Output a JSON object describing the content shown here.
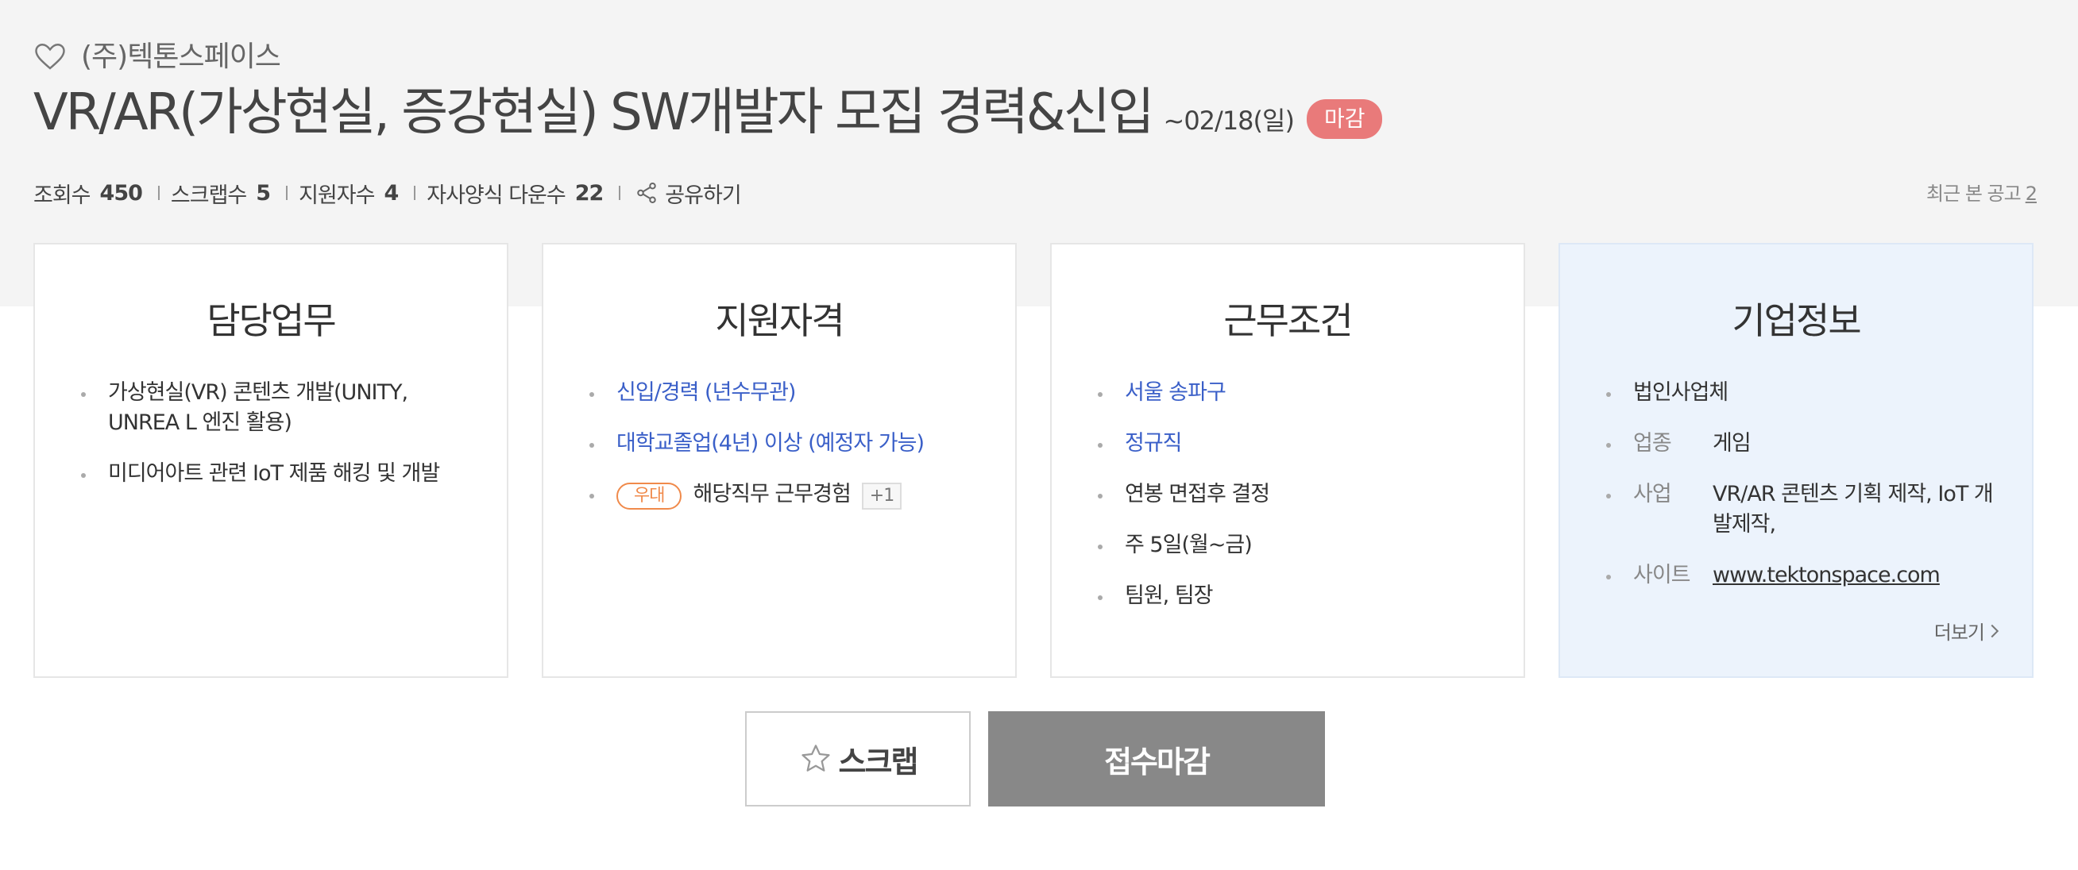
{
  "header": {
    "company_name": "(주)텍톤스페이스",
    "job_title": "VR/AR(가상현실, 증강현실) SW개발자 모집 경력&신입",
    "deadline": "~02/18(일)",
    "status_badge": "마감"
  },
  "stats": [
    {
      "label": "조회수",
      "value": "450"
    },
    {
      "label": "스크랩수",
      "value": "5"
    },
    {
      "label": "지원자수",
      "value": "4"
    },
    {
      "label": "자사양식 다운수",
      "value": "22"
    }
  ],
  "share_label": "공유하기",
  "recent": {
    "label": "최근 본 공고",
    "count": "2"
  },
  "cards": {
    "duties": {
      "title": "담당업무",
      "items": [
        "가상현실(VR) 콘텐츠 개발(UNITY, UNREA L 엔진 활용)",
        "미디어아트 관련 IoT 제품 해킹 및 개발"
      ]
    },
    "qualifications": {
      "title": "지원자격",
      "items": [
        "신입/경력 (년수무관)",
        "대학교졸업(4년) 이상 (예정자 가능)"
      ],
      "preferred_badge": "우대",
      "preferred_text": "해당직무 근무경험",
      "more_chip": "+1"
    },
    "conditions": {
      "title": "근무조건",
      "items": [
        "서울 송파구",
        "정규직",
        "연봉 면접후 결정",
        "주 5일(월~금)",
        "팀원, 팀장"
      ]
    },
    "company": {
      "title": "기업정보",
      "type": "법인사업체",
      "industry_label": "업종",
      "industry": "게임",
      "business_label": "사업",
      "business": "VR/AR 콘텐츠 기획 제작, IoT 개발제작,",
      "site_label": "사이트",
      "site": "www.tektonspace.com",
      "more_label": "더보기"
    }
  },
  "buttons": {
    "scrap": "스크랩",
    "apply": "접수마감"
  },
  "colors": {
    "closed_badge": "#e97a7a",
    "link": "#3a5fc8",
    "preferred": "#f08a4b",
    "apply_button": "#888888",
    "company_card": "#ecf3fc"
  }
}
